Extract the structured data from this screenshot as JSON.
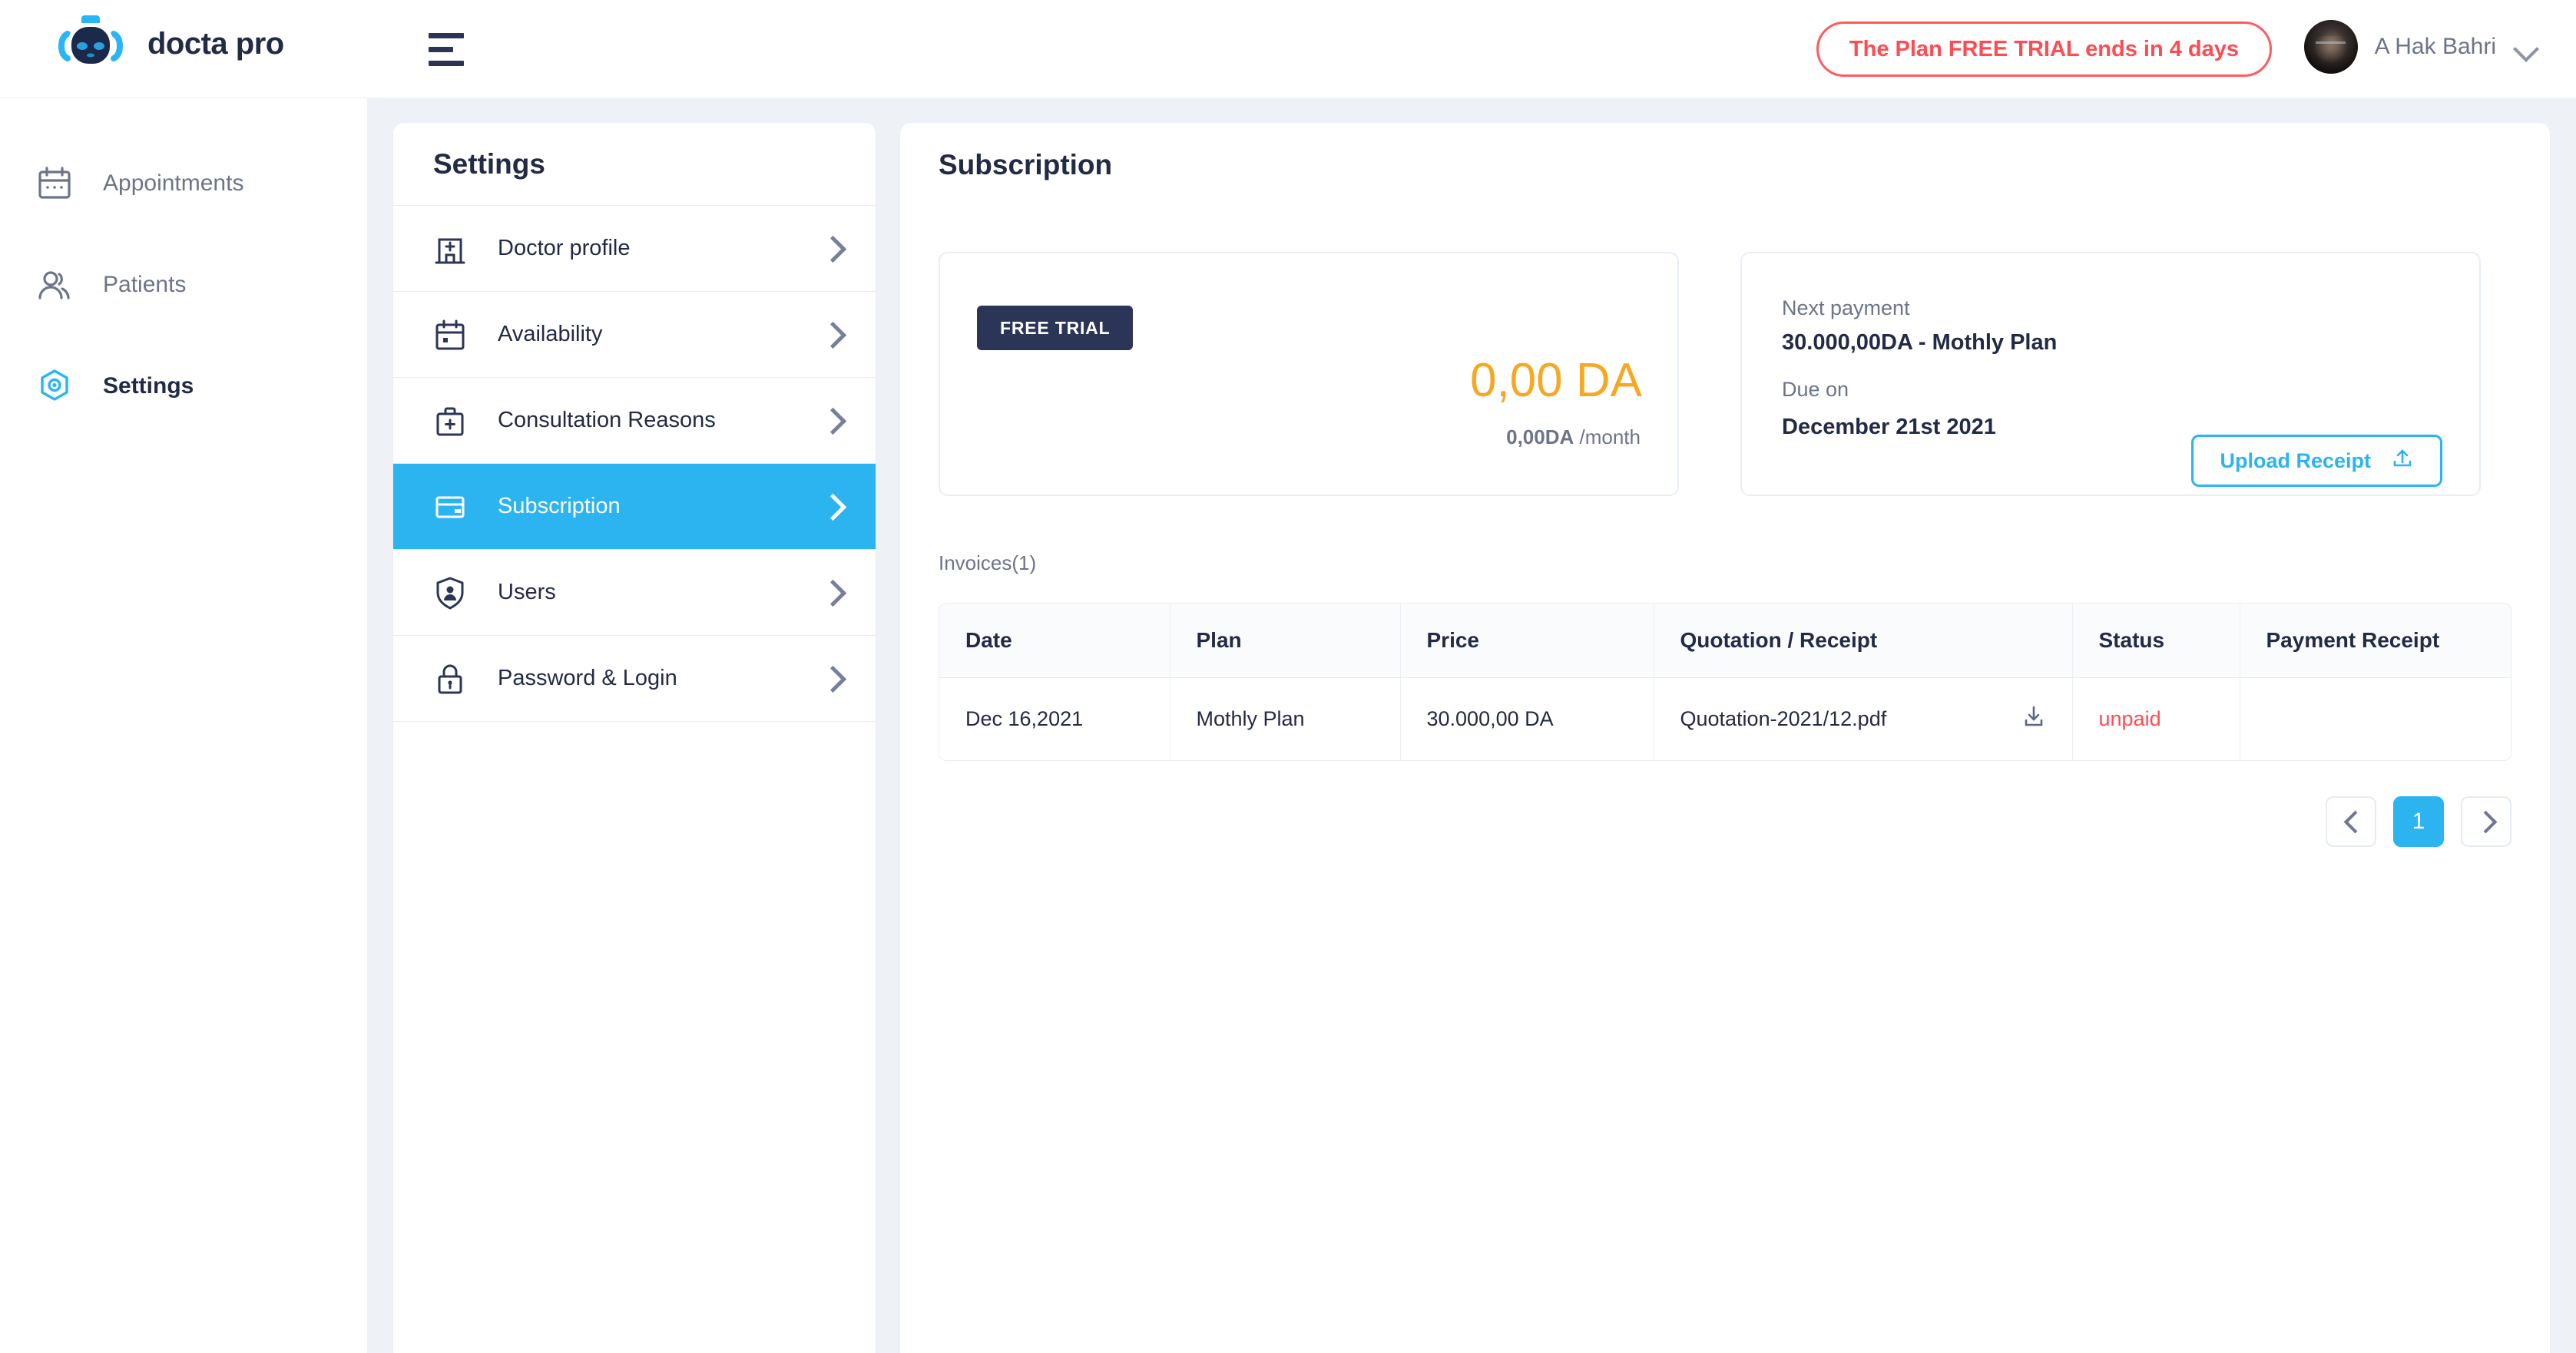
{
  "brand": {
    "name": "docta pro",
    "logo_icon": "robot-head-icon"
  },
  "header": {
    "menu_icon": "hamburger-menu-icon",
    "trial_notice": "The Plan FREE TRIAL ends in 4 days",
    "user_name": "A Hak Bahri",
    "avatar_icon": "user-avatar",
    "chevron_icon": "chevron-down-icon",
    "accent_red": "#ff4b52"
  },
  "rail": {
    "items": [
      {
        "label": "Appointments",
        "icon": "calendar-icon",
        "active": false
      },
      {
        "label": "Patients",
        "icon": "users-icon",
        "active": false
      },
      {
        "label": "Settings",
        "icon": "hexagon-gear-icon",
        "active": true
      }
    ]
  },
  "settings": {
    "title": "Settings",
    "items": [
      {
        "label": "Doctor profile",
        "icon": "hospital-icon",
        "active": false
      },
      {
        "label": "Availability",
        "icon": "calendar-icon",
        "active": false
      },
      {
        "label": "Consultation Reasons",
        "icon": "medical-bag-icon",
        "active": false
      },
      {
        "label": "Subscription",
        "icon": "credit-card-icon",
        "active": true
      },
      {
        "label": "Users",
        "icon": "shield-user-icon",
        "active": false
      },
      {
        "label": "Password & Login",
        "icon": "lock-icon",
        "active": false
      }
    ],
    "accent": "#2cb4f0"
  },
  "main": {
    "title": "Subscription",
    "plan_card": {
      "badge": "FREE TRIAL",
      "price": "0,00 DA",
      "price_per_month": "0,00DA",
      "per_month_suffix": "/month",
      "price_color": "#f7a823"
    },
    "payment_card": {
      "next_payment_label": "Next payment",
      "next_payment_value": "30.000,00DA - Mothly Plan",
      "due_on_label": "Due on",
      "due_on_value": "December 21st 2021",
      "upload_button": "Upload Receipt",
      "upload_icon": "upload-icon"
    },
    "invoices": {
      "label": "Invoices(1)",
      "columns": [
        "Date",
        "Plan",
        "Price",
        "Quotation / Receipt",
        "Status",
        "Payment Receipt"
      ],
      "rows": [
        {
          "date": "Dec 16,2021",
          "plan": "Mothly Plan",
          "price": "30.000,00 DA",
          "quotation": "Quotation-2021/12.pdf",
          "download_icon": "download-icon",
          "status": "unpaid",
          "status_color": "#ff4b52",
          "payment_receipt": ""
        }
      ]
    },
    "pagination": {
      "prev_icon": "chevron-left-icon",
      "next_icon": "chevron-right-icon",
      "pages": [
        "1"
      ],
      "current": "1"
    }
  }
}
